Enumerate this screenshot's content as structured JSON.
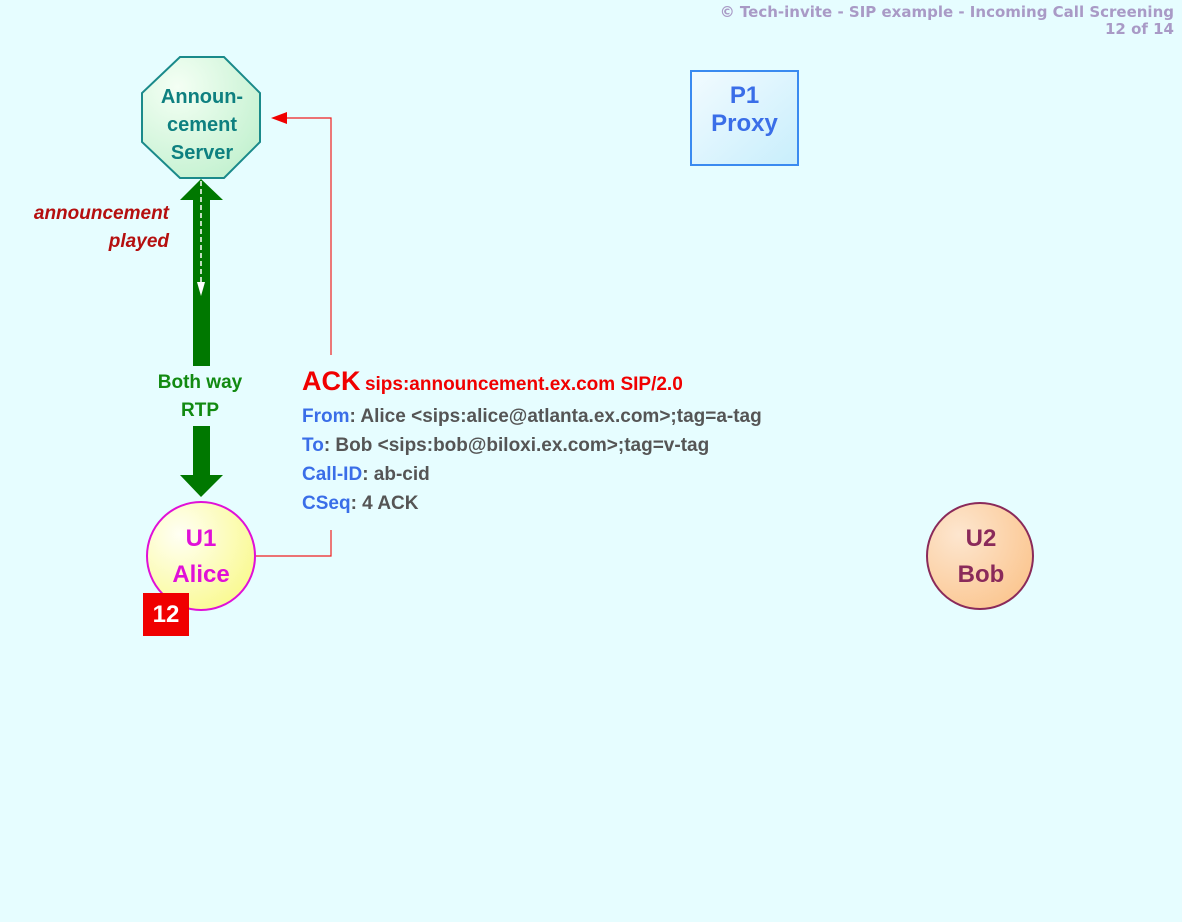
{
  "header": {
    "title": "© Tech-invite - SIP example - Incoming Call Screening",
    "page": "12 of 14"
  },
  "nodes": {
    "announcement_server": {
      "lines": [
        "Announ-",
        "cement",
        "Server"
      ]
    },
    "proxy": {
      "lines": [
        "P1",
        "Proxy"
      ]
    },
    "alice": {
      "lines": [
        "U1",
        "Alice"
      ]
    },
    "bob": {
      "lines": [
        "U2",
        "Bob"
      ]
    }
  },
  "step": {
    "number": "12"
  },
  "media": {
    "note": [
      "announcement",
      "played"
    ],
    "rtp_label": [
      "Both way",
      "RTP"
    ]
  },
  "message": {
    "method": "ACK",
    "request_uri": "sips:announcement.ex.com SIP/2.0",
    "headers": [
      {
        "name": "From",
        "value": ": Alice <sips:alice@atlanta.ex.com>;tag=a-tag"
      },
      {
        "name": "To",
        "value": ": Bob <sips:bob@biloxi.ex.com>;tag=v-tag"
      },
      {
        "name": "Call-ID",
        "value": ": ab-cid"
      },
      {
        "name": "CSeq",
        "value": ": 4 ACK"
      }
    ]
  },
  "colors": {
    "background": "#e6fdff",
    "sip_message": "#f00000",
    "rtp": "#007800",
    "header_name": "#3a6ee8",
    "header_value": "#555555",
    "announcement_note": "#b50f0f"
  }
}
